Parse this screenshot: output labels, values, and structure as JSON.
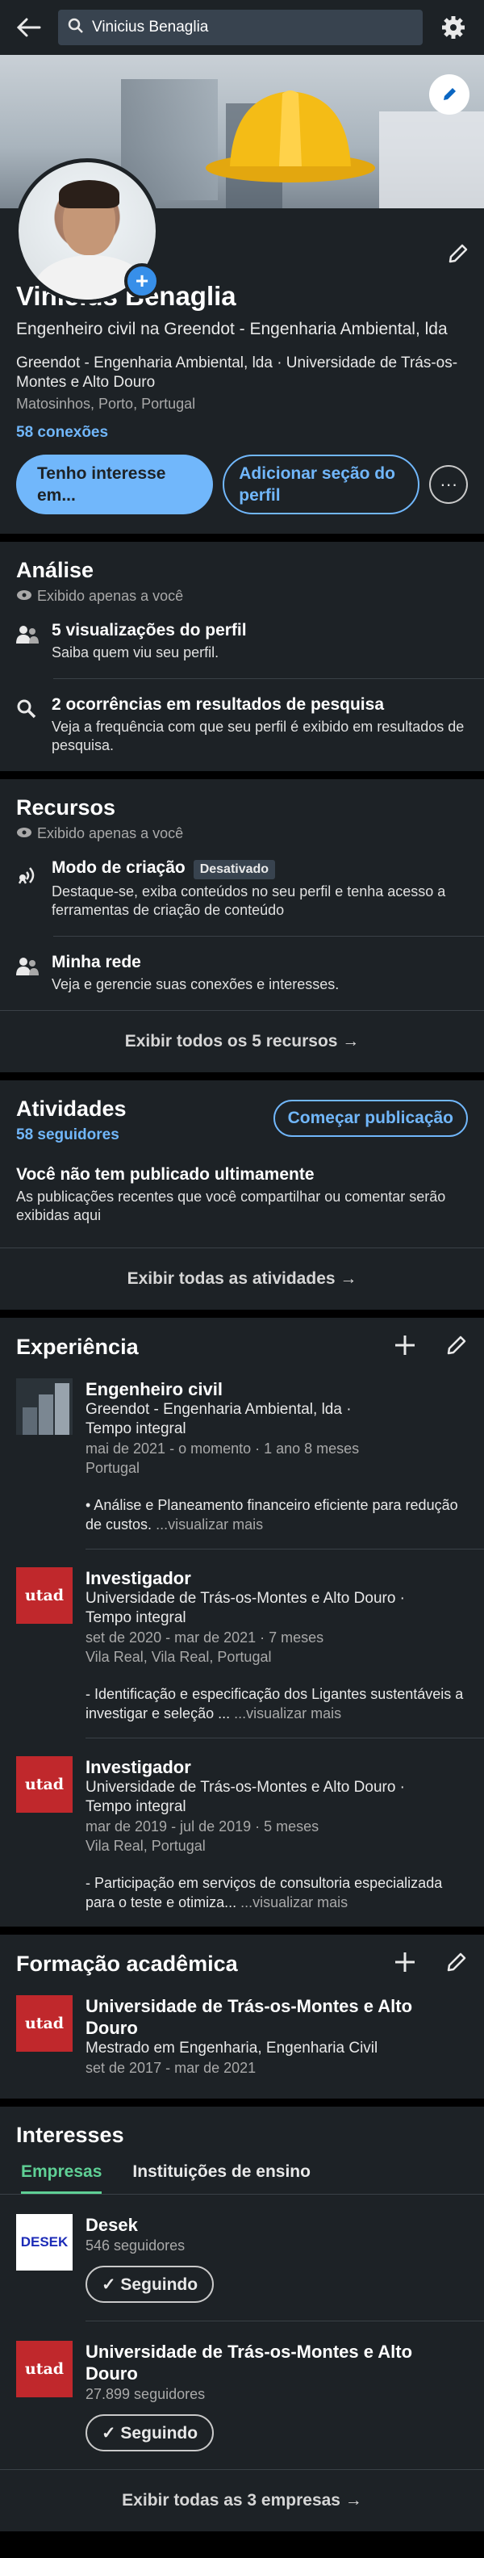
{
  "search": {
    "value": "Vinicius Benaglia"
  },
  "profile": {
    "name": "Vinicius Benaglia",
    "headline": "Engenheiro civil na Greendot - Engenharia Ambiental, lda",
    "company": "Greendot - Engenharia Ambiental, lda · Universidade de Trás-os-Montes e Alto Douro",
    "location": "Matosinhos, Porto, Portugal",
    "connections": "58 conexões",
    "btn_open": "Tenho interesse em...",
    "btn_add": "Adicionar seção do perfil",
    "btn_more": "···"
  },
  "analise": {
    "title": "Análise",
    "private": "Exibido apenas a você",
    "items": [
      {
        "title": "5 visualizações do perfil",
        "sub": "Saiba quem viu seu perfil."
      },
      {
        "title": "2 ocorrências em resultados de pesquisa",
        "sub": "Veja a frequência com que seu perfil é exibido em resultados de pesquisa."
      }
    ]
  },
  "recursos": {
    "title": "Recursos",
    "private": "Exibido apenas a você",
    "items": [
      {
        "title": "Modo de criação",
        "badge": "Desativado",
        "sub": "Destaque-se, exiba conteúdos no seu perfil e tenha acesso a ferramentas de criação de conteúdo"
      },
      {
        "title": "Minha rede",
        "sub": "Veja e gerencie suas conexões e interesses."
      }
    ],
    "footer": "Exibir todos os 5 recursos →"
  },
  "atividades": {
    "title": "Atividades",
    "followers": "58 seguidores",
    "btn_post": "Começar publicação",
    "empty_title": "Você não tem publicado ultimamente",
    "empty_sub": "As publicações recentes que você compartilhar ou comentar serão exibidas aqui",
    "footer": "Exibir todas as atividades →"
  },
  "experiencia": {
    "title": "Experiência",
    "items": [
      {
        "title": "Engenheiro civil",
        "company": "Greendot - Engenharia Ambiental, lda ·",
        "type": "Tempo integral",
        "dates": "mai de 2021 - o momento · 1 ano 8 meses",
        "place": "Portugal",
        "desc": "•      Análise e Planeamento financeiro eficiente para redução de custos.",
        "more": "...visualizar mais"
      },
      {
        "logo": "utad",
        "title": "Investigador",
        "company": "Universidade de Trás-os-Montes e Alto Douro ·",
        "type": "Tempo integral",
        "dates": "set de 2020 - mar de 2021 · 7 meses",
        "place": "Vila Real, Vila Real, Portugal",
        "desc": "- Identificação e especificação dos Ligantes sustentáveis a investigar e seleção ...",
        "more": "...visualizar mais"
      },
      {
        "logo": "utad",
        "title": "Investigador",
        "company": "Universidade de Trás-os-Montes e Alto Douro ·",
        "type": "Tempo integral",
        "dates": "mar de 2019 - jul de 2019 · 5 meses",
        "place": "Vila Real, Portugal",
        "desc": "- Participação em serviços de consultoria especializada para o teste e otimiza...",
        "more": "...visualizar mais"
      }
    ]
  },
  "formacao": {
    "title": "Formação acadêmica",
    "logo": "utad",
    "school": "Universidade de Trás-os-Montes e Alto Douro",
    "degree": "Mestrado em Engenharia, Engenharia Civil",
    "dates": "set de 2017 - mar de 2021"
  },
  "interesses": {
    "title": "Interesses",
    "tabs": [
      "Empresas",
      "Instituições de ensino"
    ],
    "items": [
      {
        "logo": "DESEK",
        "name": "Desek",
        "followers": "546 seguidores",
        "button": "✓ Seguindo"
      },
      {
        "logo": "utad",
        "name": "Universidade de Trás-os-Montes e Alto Douro",
        "followers": "27.899 seguidores",
        "button": "✓ Seguindo"
      }
    ],
    "footer": "Exibir todas as 3 empresas →"
  },
  "colors": {
    "bg": "#000000",
    "card": "#1d2226",
    "accent": "#71b7fb",
    "green": "#5fd095",
    "utad": "#c0282c"
  },
  "icons": [
    "back-arrow-icon",
    "search-icon",
    "gear-icon",
    "pencil-icon",
    "eye-icon",
    "people-icon",
    "search-icon",
    "broadcast-icon",
    "plus-icon"
  ]
}
